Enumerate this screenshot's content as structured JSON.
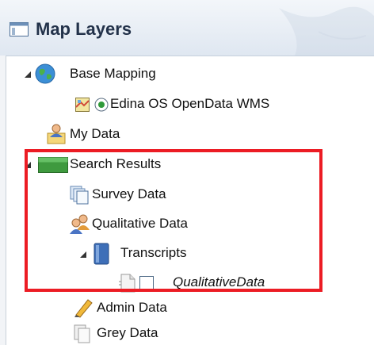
{
  "panel": {
    "title": "Map Layers"
  },
  "tree": {
    "base_mapping": "Base Mapping",
    "edina": "Edina OS OpenData WMS",
    "my_data": "My Data",
    "search_results": "Search Results",
    "survey_data": "Survey Data",
    "qualitative_data": "Qualitative Data",
    "transcripts": "Transcripts",
    "qualitative_leaf": "QualitativeData",
    "admin_data": "Admin Data",
    "grey_data": "Grey Data"
  },
  "colors": {
    "highlight": "#ec1c24",
    "title": "#23324a"
  }
}
